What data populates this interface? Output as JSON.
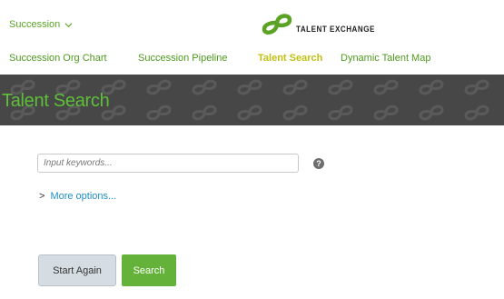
{
  "header": {
    "module_label": "Succession",
    "logo_text": "TALENT EXCHANGE"
  },
  "nav": {
    "tabs": [
      {
        "label": "Succession Org Chart",
        "active": false
      },
      {
        "label": "Succession Pipeline",
        "active": false
      },
      {
        "label": "Talent Search",
        "active": true
      },
      {
        "label": "Dynamic Talent Map",
        "active": false
      }
    ]
  },
  "page": {
    "title": "Talent Search"
  },
  "search": {
    "placeholder": "Input keywords...",
    "value": "",
    "help_icon": "?",
    "more_options_label": "More options...",
    "more_options_caret": ">",
    "reset_label": "Start Again",
    "submit_label": "Search"
  },
  "colors": {
    "brand_green": "#64b23a",
    "active_tab": "#c0c013",
    "banner_bg": "#474747",
    "link_blue": "#1f8fc6"
  }
}
